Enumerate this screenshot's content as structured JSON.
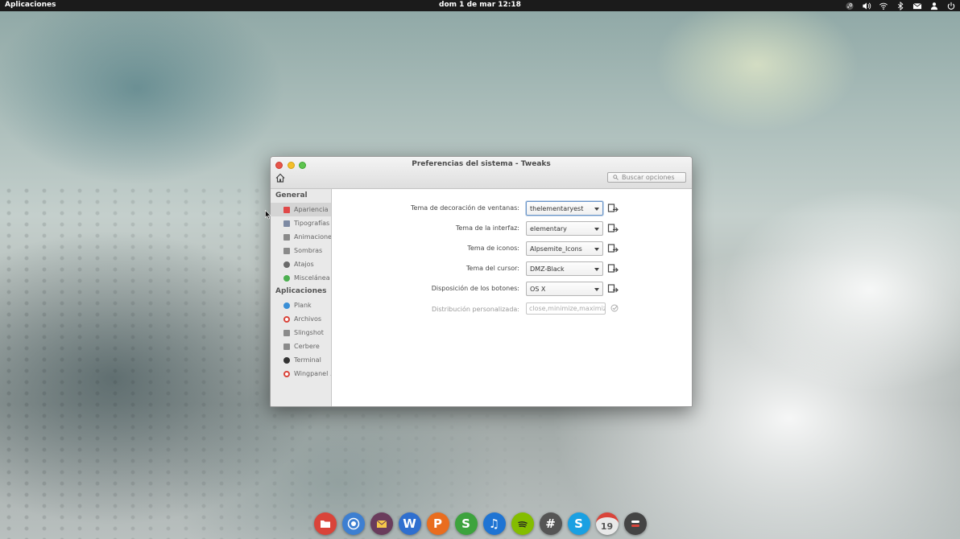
{
  "panel": {
    "apps_label": "Aplicaciones",
    "clock": "dom  1 de mar 12:18",
    "tray": [
      "steam-icon",
      "volume-icon",
      "wifi-icon",
      "bluetooth-icon",
      "mail-icon",
      "user-icon",
      "power-icon"
    ]
  },
  "window": {
    "title": "Preferencias del sistema - Tweaks",
    "search_placeholder": "Buscar opciones",
    "sidebar": {
      "general_header": "General",
      "general_items": [
        {
          "label": "Apariencia",
          "selected": true,
          "icon": "appearance-icon",
          "color": "#e04848"
        },
        {
          "label": "Tipografías",
          "icon": "fonts-icon",
          "color": "#7d8aa3"
        },
        {
          "label": "Animaciones",
          "icon": "animations-icon",
          "color": "#8a8a8a"
        },
        {
          "label": "Sombras",
          "icon": "shadows-icon",
          "color": "#8a8a8a"
        },
        {
          "label": "Atajos",
          "icon": "shortcuts-icon",
          "color": "#6a6a6a"
        },
        {
          "label": "Miscelánea",
          "icon": "misc-icon",
          "color": "#4caf50"
        }
      ],
      "apps_header": "Aplicaciones",
      "app_items": [
        {
          "label": "Plank",
          "icon": "plank-icon",
          "color": "#3a8fd6"
        },
        {
          "label": "Archivos",
          "icon": "files-icon",
          "color": "#d9443a"
        },
        {
          "label": "Slingshot",
          "icon": "slingshot-icon",
          "color": "#8a8a8a"
        },
        {
          "label": "Cerbere",
          "icon": "cerbere-icon",
          "color": "#8a8a8a"
        },
        {
          "label": "Terminal",
          "icon": "terminal-icon",
          "color": "#333333"
        },
        {
          "label": "Wingpanel ...",
          "icon": "wingpanel-icon",
          "color": "#d9443a"
        }
      ]
    },
    "settings": [
      {
        "label": "Tema de decoración de ventanas:",
        "value": "thelementaryest",
        "type": "combo",
        "focused": true
      },
      {
        "label": "Tema de la interfaz:",
        "value": "elementary",
        "type": "combo"
      },
      {
        "label": "Tema de iconos:",
        "value": "Alpsemite_Icons",
        "type": "combo"
      },
      {
        "label": "Tema del cursor:",
        "value": "DMZ-Black",
        "type": "combo"
      },
      {
        "label": "Disposición de los botones:",
        "value": "OS X",
        "type": "combo"
      },
      {
        "label": "Distribución personalizada:",
        "placeholder": "close,minimize,maximize:",
        "type": "entry",
        "disabled": true
      }
    ]
  },
  "dock": [
    {
      "name": "files",
      "icon": "folder-icon",
      "color": "#d9443a"
    },
    {
      "name": "chromium",
      "icon": "chromium-icon",
      "color": "#3d7fd1"
    },
    {
      "name": "mail",
      "icon": "mail-icon",
      "color": "#6a3c5c"
    },
    {
      "name": "writer",
      "icon": "writer-icon",
      "color": "#2f6fcf",
      "glyph": "W"
    },
    {
      "name": "presentation",
      "icon": "presentation-icon",
      "color": "#e96d1f",
      "glyph": "P"
    },
    {
      "name": "spreadsheet",
      "icon": "spreadsheet-icon",
      "color": "#3da33d",
      "glyph": "S"
    },
    {
      "name": "music",
      "icon": "music-icon",
      "color": "#1f74d3",
      "glyph": "♫"
    },
    {
      "name": "spotify",
      "icon": "spotify-icon",
      "color": "#84bd00"
    },
    {
      "name": "hashtag",
      "icon": "hashtag-icon",
      "color": "#555555",
      "glyph": "#"
    },
    {
      "name": "skype",
      "icon": "skype-icon",
      "color": "#1aa0e2",
      "glyph": "S"
    },
    {
      "name": "calendar",
      "icon": "calendar-icon",
      "color": "#e0e0e0",
      "glyph": "19"
    },
    {
      "name": "switchboard",
      "icon": "settings-icon",
      "color": "#444444"
    }
  ]
}
